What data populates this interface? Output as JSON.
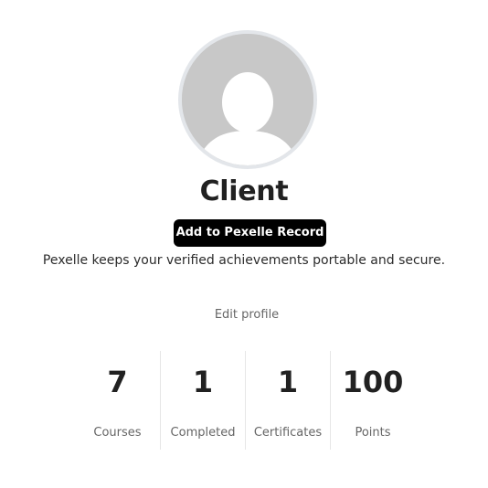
{
  "profile": {
    "name": "Client",
    "add_record_label": "Add to Pexelle Record",
    "tagline": "Pexelle keeps your verified achievements portable and secure.",
    "edit_profile_label": "Edit profile",
    "avatar_icon": "default-user-avatar-icon"
  },
  "stats": [
    {
      "value": "7",
      "label": "Courses"
    },
    {
      "value": "1",
      "label": "Completed"
    },
    {
      "value": "1",
      "label": "Certificates"
    },
    {
      "value": "100",
      "label": "Points"
    }
  ],
  "colors": {
    "background": "#ffffff",
    "avatar_fill": "#c8c8c8",
    "avatar_ring": "#e3e6ea",
    "button_bg": "#000000",
    "button_text": "#ffffff",
    "muted_text": "#666666",
    "divider": "#e6e6e6"
  }
}
